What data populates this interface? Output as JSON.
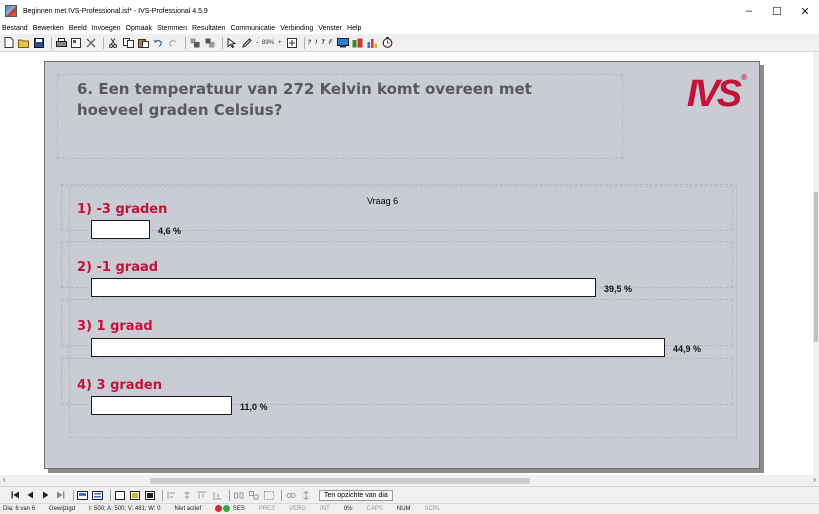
{
  "window": {
    "title": "Beginnen met IVS-Professional.isf* - IVS-Professional 4.5.9",
    "controls": [
      "–",
      "☐",
      "✕"
    ]
  },
  "menu": [
    "Bestand",
    "Bewerken",
    "Beeld",
    "Invoegen",
    "Opmaak",
    "Stemmen",
    "Resultaten",
    "Communicatie",
    "Verbinding",
    "Venster",
    "Help"
  ],
  "toolbar": {
    "zoom_minus": "-",
    "zoom_level": "89%",
    "zoom_plus": "+",
    "text_buttons": [
      "?",
      "!",
      "T",
      "F"
    ]
  },
  "slide": {
    "question": "6. Een temperatuur van 272 Kelvin komt overeen met hoeveel graden Celsius?",
    "logo_text": "IVS",
    "logo_mark": "®",
    "chart_title": "Vraag 6",
    "answers": [
      {
        "label": "1) -3 graden",
        "value": "4,6 %"
      },
      {
        "label": "2) -1 graad",
        "value": "39,5 %"
      },
      {
        "label": "3) 1 graad",
        "value": "44,9 %"
      },
      {
        "label": "4) 3 graden",
        "value": "11,0 %"
      }
    ]
  },
  "chart_data": {
    "type": "bar",
    "title": "Vraag 6",
    "categories": [
      "1) -3 graden",
      "2) -1 graad",
      "3) 1 graad",
      "4) 3 graden"
    ],
    "values": [
      4.6,
      39.5,
      44.9,
      11.0
    ],
    "value_labels": [
      "4,6 %",
      "39,5 %",
      "44,9 %",
      "11,0 %"
    ],
    "orientation": "horizontal",
    "xlim": [
      0,
      44.9
    ]
  },
  "navigation": {
    "overview_button": "Ten opzichte van dia"
  },
  "status": {
    "slide": "Dia: 6 van 6",
    "modified": "Gewijzigd",
    "counts": "I: 500;  A: 500;  V: 481;  W: 0",
    "activity": "Niet actief",
    "ses": "SES",
    "pres": "PRES",
    "verg": "VERG",
    "int": "INT",
    "percent": "0%",
    "caps": "CAPS",
    "num": "NUM",
    "scrl": "SCRL"
  }
}
